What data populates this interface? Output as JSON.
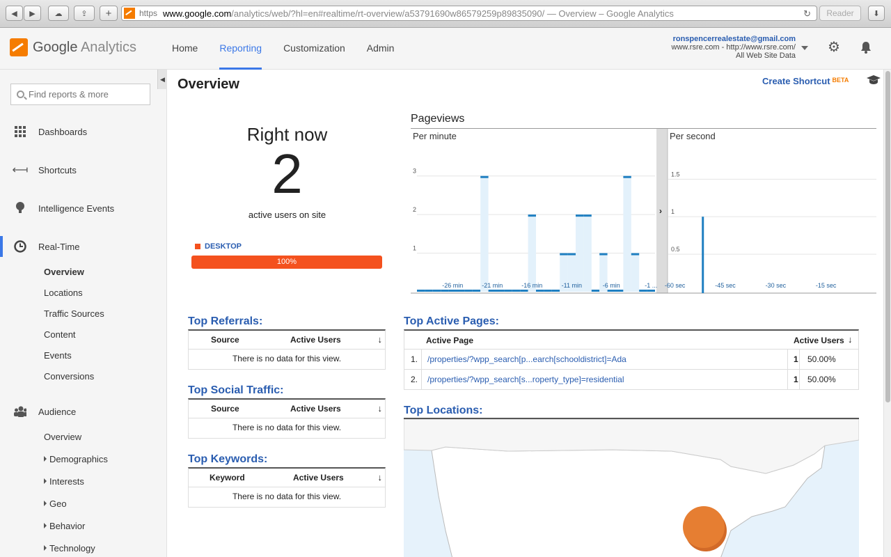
{
  "browser": {
    "https_label": "https",
    "url_host": "www.google.com",
    "url_path": "/analytics/web/?hl=en#realtime/rt-overview/a53791690w86579259p89835090/",
    "page_title": " — Overview – Google Analytics",
    "reader_label": "Reader"
  },
  "header": {
    "logo_google": "Google",
    "logo_analytics": " Analytics",
    "nav": [
      {
        "label": "Home"
      },
      {
        "label": "Reporting"
      },
      {
        "label": "Customization"
      },
      {
        "label": "Admin"
      }
    ],
    "account_email": "ronspencerrealestate@gmail.com",
    "account_property": "www.rsre.com - http://www.rsre.com/",
    "account_view": "All Web Site Data"
  },
  "sidebar": {
    "search_placeholder": "Find reports & more",
    "items": [
      {
        "label": "Dashboards",
        "icon": "dashboards-icon"
      },
      {
        "label": "Shortcuts",
        "icon": "shortcuts-icon"
      },
      {
        "label": "Intelligence Events",
        "icon": "intelligence-icon"
      },
      {
        "label": "Real-Time",
        "icon": "clock-icon"
      },
      {
        "label": "Audience",
        "icon": "audience-icon"
      }
    ],
    "realtime_sub": [
      "Overview",
      "Locations",
      "Traffic Sources",
      "Content",
      "Events",
      "Conversions"
    ],
    "audience_sub": [
      "Overview",
      "Demographics",
      "Interests",
      "Geo",
      "Behavior",
      "Technology"
    ]
  },
  "main": {
    "title": "Overview",
    "create_shortcut": "Create Shortcut",
    "beta": "BETA",
    "right_now_label": "Right now",
    "active_users": "2",
    "active_users_sub": "active users on site",
    "device_label": "DESKTOP",
    "device_percent": "100%",
    "device_fraction": 1.0,
    "pageviews_title": "Pageviews",
    "per_minute_label": "Per minute",
    "per_second_label": "Per second",
    "top_referrals": {
      "title": "Top Referrals:",
      "col1": "Source",
      "col2": "Active Users",
      "empty": "There is no data for this view."
    },
    "top_social": {
      "title": "Top Social Traffic:",
      "col1": "Source",
      "col2": "Active Users",
      "empty": "There is no data for this view."
    },
    "top_keywords": {
      "title": "Top Keywords:",
      "col1": "Keyword",
      "col2": "Active Users",
      "empty": "There is no data for this view."
    },
    "top_pages": {
      "title": "Top Active Pages:",
      "col1": "Active Page",
      "col2": "Active Users",
      "rows": [
        {
          "rank": "1.",
          "page": "/properties/?wpp_search[p...earch[schooldistrict]=Ada",
          "users": "1",
          "percent": "50.00%"
        },
        {
          "rank": "2.",
          "page": "/properties/?wpp_search[s...roperty_type]=residential",
          "users": "1",
          "percent": "50.00%"
        }
      ]
    },
    "top_locations_title": "Top Locations:"
  },
  "chart_data": [
    {
      "type": "bar",
      "title": "Per minute",
      "x_tick_labels": [
        "-26 min",
        "-21 min",
        "-16 min",
        "-11 min",
        "-6 min",
        "-1 ..."
      ],
      "y_tick_labels": [
        "1",
        "2",
        "3"
      ],
      "ylim": [
        0,
        3.5
      ],
      "x": [
        -30,
        -29,
        -28,
        -27,
        -26,
        -25,
        -24,
        -23,
        -22,
        -21,
        -20,
        -19,
        -18,
        -17,
        -16,
        -15,
        -14,
        -13,
        -12,
        -11,
        -10,
        -9,
        -8,
        -7,
        -6,
        -5,
        -4,
        -3,
        -2,
        -1
      ],
      "values": [
        0,
        0,
        0,
        0,
        0,
        0,
        0,
        0,
        3,
        0,
        0,
        0,
        0,
        0,
        2,
        0,
        0,
        0,
        1,
        1,
        2,
        2,
        0,
        1,
        0,
        0,
        3,
        1,
        0,
        0
      ],
      "color": "#1f7fc1",
      "fill_color": "#e3f1fb"
    },
    {
      "type": "bar",
      "title": "Per second",
      "x_tick_labels": [
        "-60 sec",
        "-45 sec",
        "-30 sec",
        "-15 sec"
      ],
      "y_tick_labels": [
        "0.5",
        "1",
        "1.5"
      ],
      "ylim": [
        0,
        1.8
      ],
      "bars": [
        {
          "x": -52,
          "value": 1
        }
      ],
      "color": "#1f7fc1"
    }
  ]
}
